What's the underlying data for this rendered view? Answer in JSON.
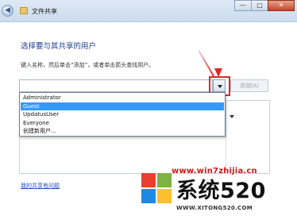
{
  "window": {
    "title": "文件共享",
    "back_glyph": "◀",
    "minimize_glyph": "—",
    "maximize_glyph": "□",
    "close_glyph": "✕"
  },
  "main": {
    "heading": "选择要与其共享的用户",
    "hint": "键入名称，然后单击“添加”，或者单击箭头查找用户。",
    "name_input_value": "",
    "add_button_label": "添加(A)",
    "dropdown_items": [
      "Administrator",
      "Guest",
      "UpdatusUser",
      "Everyone",
      "创建新用户..."
    ],
    "selected_item": "Guest",
    "link_text": "我的共享有问题"
  },
  "watermark": {
    "url_text": "www.win7zhijia.cn",
    "brand_text": "系统520",
    "brand_url": "WWW.XITONG520.COM"
  },
  "colors": {
    "accent_red": "#e0262a",
    "selection_blue": "#3399ff",
    "heading_blue": "#1d3d8f"
  }
}
